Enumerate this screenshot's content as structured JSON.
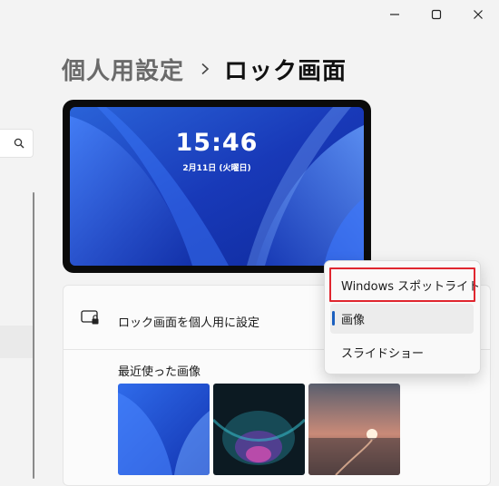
{
  "window": {
    "controls": {
      "minimize": "minimize-icon",
      "maximize": "maximize-icon",
      "close": "close-icon"
    }
  },
  "breadcrumb": {
    "parent": "個人用設定",
    "separator_icon": "chevron-right-icon",
    "current": "ロック画面"
  },
  "sidebar": {
    "search_icon": "search-icon"
  },
  "preview": {
    "time": "15:46",
    "date": "2月11日 (火曜日)"
  },
  "card": {
    "personalize": {
      "icon": "lock-screen-icon",
      "label": "ロック画面を個人用に設定"
    },
    "recent_images": {
      "label": "最近使った画像",
      "thumbnails": [
        "blue-bloom-wallpaper",
        "dark-glow-wallpaper",
        "sunset-lake-photo"
      ]
    }
  },
  "dropdown": {
    "options": [
      "Windows スポットライト",
      "画像",
      "スライドショー"
    ],
    "selected": "画像",
    "highlighted": "Windows スポットライト"
  },
  "colors": {
    "accent": "#1b5fbf",
    "highlight_box": "#e0262f",
    "background": "#f3f3f3"
  }
}
